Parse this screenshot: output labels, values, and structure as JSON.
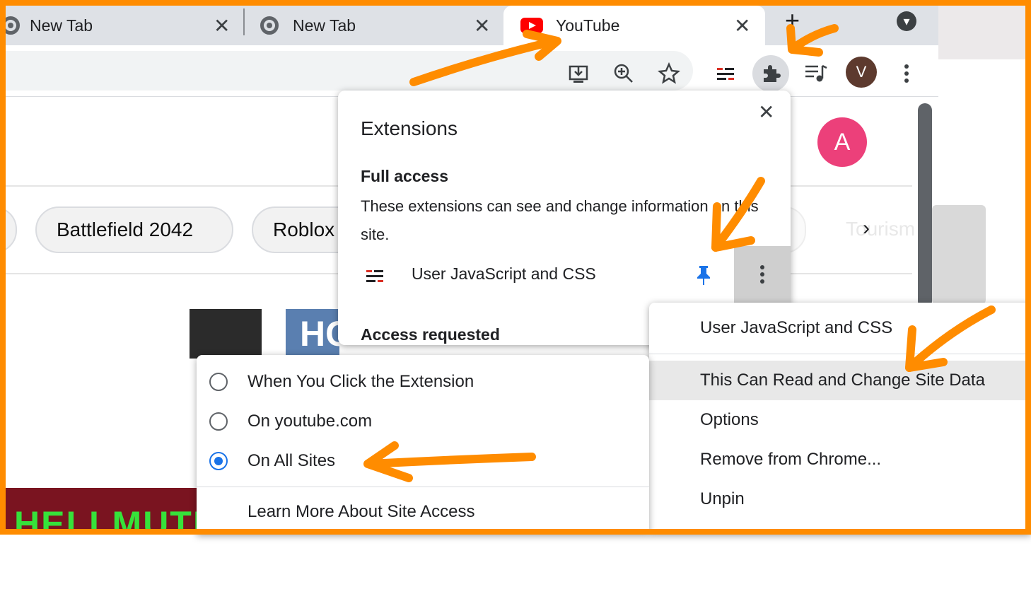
{
  "colors": {
    "annotation": "#ff8c00",
    "accent": "#1a73e8",
    "youtube_red": "#ff0000"
  },
  "tabs": [
    {
      "label": "New Tab",
      "icon": "chrome-icon",
      "active": false
    },
    {
      "label": "New Tab",
      "icon": "chrome-icon",
      "active": false
    },
    {
      "label": "YouTube",
      "icon": "youtube-icon",
      "active": true
    }
  ],
  "tab_close_glyph": "✕",
  "new_tab_glyph": "+",
  "tab_search_glyph": "▾",
  "toolbar": {
    "icons": [
      "install-icon",
      "zoom-icon",
      "bookmark-star-icon",
      "user-js-css-icon",
      "extensions-puzzle-icon",
      "media-queue-icon",
      "profile-avatar",
      "more-menu-icon"
    ],
    "profile_initial": "V"
  },
  "youtube": {
    "account_initial": "A",
    "chips": [
      "Battlefield 2042",
      "Roblox"
    ],
    "faded_chip": "Tourism",
    "thumb_text": "HELLMUTH",
    "thumb_blue_text": "HC"
  },
  "extensions_popup": {
    "title": "Extensions",
    "full_access_heading": "Full access",
    "full_access_desc": "These extensions can see and change information on this site.",
    "extension_name": "User JavaScript and CSS",
    "access_requested_heading": "Access requested"
  },
  "context_menu": {
    "title": "User JavaScript and CSS",
    "items": [
      "This Can Read and Change Site Data",
      "Options",
      "Remove from Chrome...",
      "Unpin"
    ]
  },
  "site_access_menu": {
    "options": [
      {
        "label": "When You Click the Extension",
        "selected": false
      },
      {
        "label": "On youtube.com",
        "selected": false
      },
      {
        "label": "On All Sites",
        "selected": true
      }
    ],
    "learn_more": "Learn More About Site Access"
  }
}
